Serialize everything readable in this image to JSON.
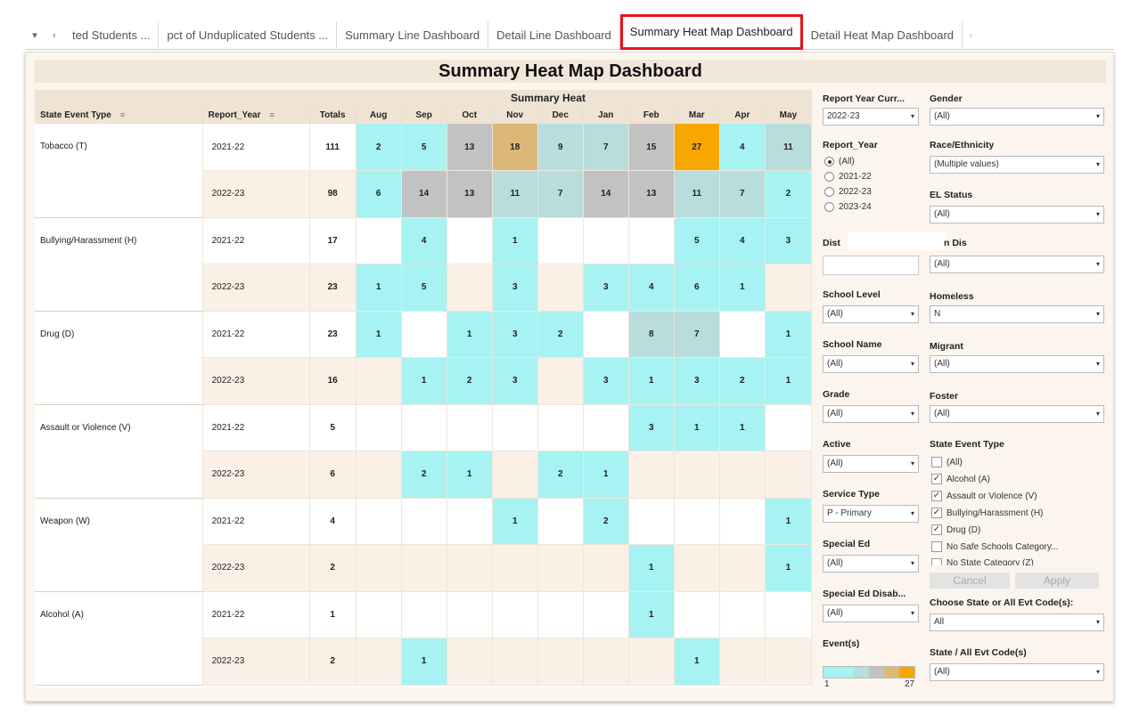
{
  "tabs": {
    "dropdown_icon": "▾",
    "prev_icon": "‹",
    "next_icon": "›",
    "items": [
      "ted Students ...",
      "pct of Unduplicated Students ...",
      "Summary Line Dashboard",
      "Detail Line Dashboard",
      "Summary Heat Map Dashboard",
      "Detail Heat Map Dashboard"
    ],
    "active_index": 4,
    "highlight_color": "#e8121b"
  },
  "dashboard": {
    "title": "Summary Heat Map Dashboard"
  },
  "heat": {
    "caption": "Summary Heat",
    "headers": {
      "type": "State Event Type",
      "year": "Report_Year",
      "totals": "Totals",
      "months": [
        "Aug",
        "Sep",
        "Oct",
        "Nov",
        "Dec",
        "Jan",
        "Feb",
        "Mar",
        "Apr",
        "May"
      ]
    },
    "sort_icon": "≡",
    "groups": [
      {
        "type": "Tobacco (T)",
        "rows": [
          {
            "year": "2021-22",
            "total": "111",
            "months": [
              "2",
              "5",
              "13",
              "18",
              "9",
              "7",
              "15",
              "27",
              "4",
              "11"
            ]
          },
          {
            "year": "2022-23",
            "total": "98",
            "months": [
              "6",
              "14",
              "13",
              "11",
              "7",
              "14",
              "13",
              "11",
              "7",
              "2"
            ]
          }
        ]
      },
      {
        "type": "Bullying/Harassment (H)",
        "rows": [
          {
            "year": "2021-22",
            "total": "17",
            "months": [
              "",
              "4",
              "",
              "1",
              "",
              "",
              "",
              "5",
              "4",
              "3"
            ]
          },
          {
            "year": "2022-23",
            "total": "23",
            "months": [
              "1",
              "5",
              "",
              "3",
              "",
              "3",
              "4",
              "6",
              "1",
              ""
            ]
          }
        ]
      },
      {
        "type": "Drug (D)",
        "rows": [
          {
            "year": "2021-22",
            "total": "23",
            "months": [
              "1",
              "",
              "1",
              "3",
              "2",
              "",
              "8",
              "7",
              "",
              "1"
            ]
          },
          {
            "year": "2022-23",
            "total": "16",
            "months": [
              "",
              "1",
              "2",
              "3",
              "",
              "3",
              "1",
              "3",
              "2",
              "1"
            ]
          }
        ]
      },
      {
        "type": "Assault or Violence (V)",
        "rows": [
          {
            "year": "2021-22",
            "total": "5",
            "months": [
              "",
              "",
              "",
              "",
              "",
              "",
              "3",
              "1",
              "1",
              ""
            ]
          },
          {
            "year": "2022-23",
            "total": "6",
            "months": [
              "",
              "2",
              "1",
              "",
              "2",
              "1",
              "",
              "",
              "",
              ""
            ]
          }
        ]
      },
      {
        "type": "Weapon (W)",
        "rows": [
          {
            "year": "2021-22",
            "total": "4",
            "months": [
              "",
              "",
              "",
              "1",
              "",
              "2",
              "",
              "",
              "",
              "1"
            ]
          },
          {
            "year": "2022-23",
            "total": "2",
            "months": [
              "",
              "",
              "",
              "",
              "",
              "",
              "1",
              "",
              "",
              "1"
            ]
          }
        ]
      },
      {
        "type": "Alcohol (A)",
        "rows": [
          {
            "year": "2021-22",
            "total": "1",
            "months": [
              "",
              "",
              "",
              "",
              "",
              "",
              "1",
              "",
              "",
              ""
            ]
          },
          {
            "year": "2022-23",
            "total": "2",
            "months": [
              "",
              "1",
              "",
              "",
              "",
              "",
              "",
              "1",
              "",
              ""
            ]
          }
        ]
      }
    ],
    "colors": {
      "cyan": "#a7f2f2",
      "teal": "#b9dcdc",
      "gray": "#c2c2c2",
      "tan": "#dcb878",
      "orange": "#f7a700"
    }
  },
  "filters": {
    "report_year_curr": {
      "label": "Report Year Curr...",
      "value": "2022-23"
    },
    "gender": {
      "label": "Gender",
      "value": "(All)"
    },
    "report_year": {
      "label": "Report_Year",
      "options": [
        "(All)",
        "2021-22",
        "2022-23",
        "2023-24"
      ],
      "selected_index": 0
    },
    "race": {
      "label": "Race/Ethnicity",
      "value": "(Multiple values)"
    },
    "el_status": {
      "label": "EL Status",
      "value": "(All)"
    },
    "district_label": "Dist",
    "district_tail": "n Dis",
    "district_right_value": "(All)",
    "school_level": {
      "label": "School Level",
      "value": "(All)"
    },
    "homeless": {
      "label": "Homeless",
      "value": "N"
    },
    "school_name": {
      "label": "School Name",
      "value": "(All)"
    },
    "migrant": {
      "label": "Migrant",
      "value": "(All)"
    },
    "grade": {
      "label": "Grade",
      "value": "(All)"
    },
    "foster": {
      "label": "Foster",
      "value": "(All)"
    },
    "active": {
      "label": "Active",
      "value": "(All)"
    },
    "state_event_type": {
      "label": "State Event Type",
      "options": [
        {
          "text": "(All)",
          "checked": false
        },
        {
          "text": "Alcohol (A)",
          "checked": true
        },
        {
          "text": "Assault or Violence (V)",
          "checked": true
        },
        {
          "text": "Bullying/Harassment (H)",
          "checked": true
        },
        {
          "text": "Drug (D)",
          "checked": true
        },
        {
          "text": "No Safe Schools Category...",
          "checked": false
        },
        {
          "text": "No State Category (Z)",
          "checked": false
        }
      ],
      "check_glyph": "✓",
      "cancel": "Cancel",
      "apply": "Apply"
    },
    "service_type": {
      "label": "Service Type",
      "value": "P - Primary"
    },
    "special_ed": {
      "label": "Special Ed",
      "value": "(All)"
    },
    "special_ed_disab": {
      "label": "Special Ed Disab...",
      "value": "(All)"
    },
    "choose_code": {
      "label": "Choose State or All Evt Code(s):",
      "value": "All"
    },
    "events_legend": {
      "label": "Event(s)",
      "min": "1",
      "max": "27"
    },
    "state_all_codes": {
      "label": "State / All Evt Code(s)",
      "value": "(All)"
    },
    "caret": "▾"
  }
}
